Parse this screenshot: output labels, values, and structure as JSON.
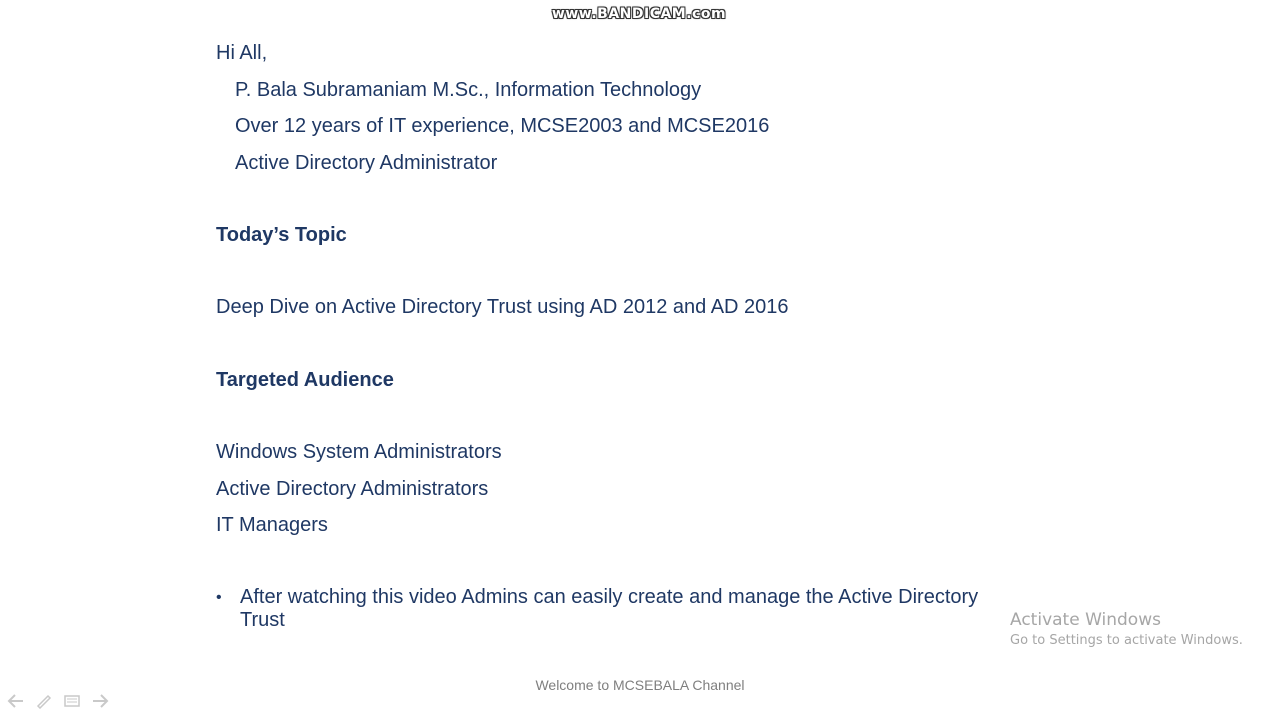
{
  "watermark": "www.BANDICAM.com",
  "intro": {
    "greeting": "Hi All,",
    "lines": [
      "P. Bala Subramaniam  M.Sc., Information Technology",
      "Over 12 years of IT experience, MCSE2003 and MCSE2016",
      "Active Directory Administrator"
    ]
  },
  "topic": {
    "heading": "Today’s Topic",
    "text": "Deep Dive on Active Directory Trust using AD 2012 and AD 2016"
  },
  "audience": {
    "heading": "Targeted Audience",
    "items": [
      "Windows System Administrators",
      "Active Directory Administrators",
      "IT Managers"
    ]
  },
  "bullet": {
    "symbol": "•",
    "text_line1": "After watching this video Admins can easily create and manage the Active Directory",
    "text_line2": "Trust"
  },
  "activation": {
    "title": "Activate Windows",
    "subtitle": "Go to Settings to activate Windows."
  },
  "footer": "Welcome to MCSEBALA Channel",
  "colors": {
    "text": "#1f3864",
    "watermark_text": "#a6a6a6",
    "footer": "#7f7f7f"
  }
}
